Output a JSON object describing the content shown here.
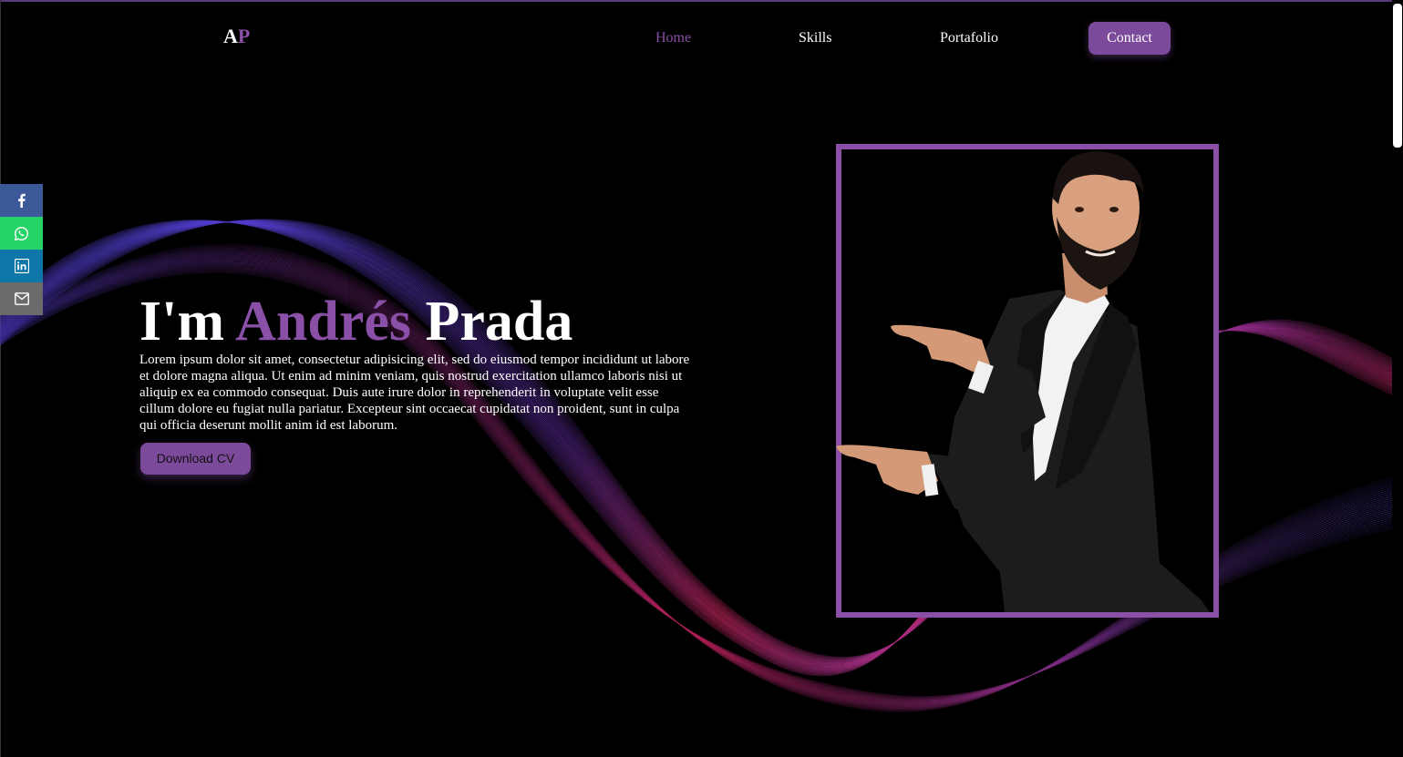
{
  "nav": {
    "logo_first": "A",
    "logo_second": "P",
    "home": "Home",
    "skills": "Skills",
    "portfolio": "Portafolio",
    "contact": "Contact"
  },
  "social": [
    {
      "icon": "facebook-icon",
      "color": "#3b5998"
    },
    {
      "icon": "whatsapp-icon",
      "color": "#25d366"
    },
    {
      "icon": "linkedin-icon",
      "color": "#0e76a8"
    },
    {
      "icon": "mail-icon",
      "color": "#6b6b6b"
    }
  ],
  "hero": {
    "title_prefix": "I'm ",
    "title_highlight": "Andrés",
    "title_suffix": " Prada",
    "description": "Lorem ipsum dolor sit amet, consectetur adipisicing elit, sed do eiusmod tempor incididunt ut labore et dolore magna aliqua. Ut enim ad minim veniam, quis nostrud exercitation ullamco laboris nisi ut aliquip ex ea commodo consequat. Duis aute irure dolor in reprehenderit in voluptate velit esse cillum dolore eu fugiat nulla pariatur. Excepteur sint occaecat cupidatat non proident, sunt in culpa qui officia deserunt mollit anim id est laborum.",
    "download_label": "Download CV"
  },
  "colors": {
    "accent": "#8a4fa6",
    "button": "#7c4a9b",
    "background": "#000000"
  }
}
